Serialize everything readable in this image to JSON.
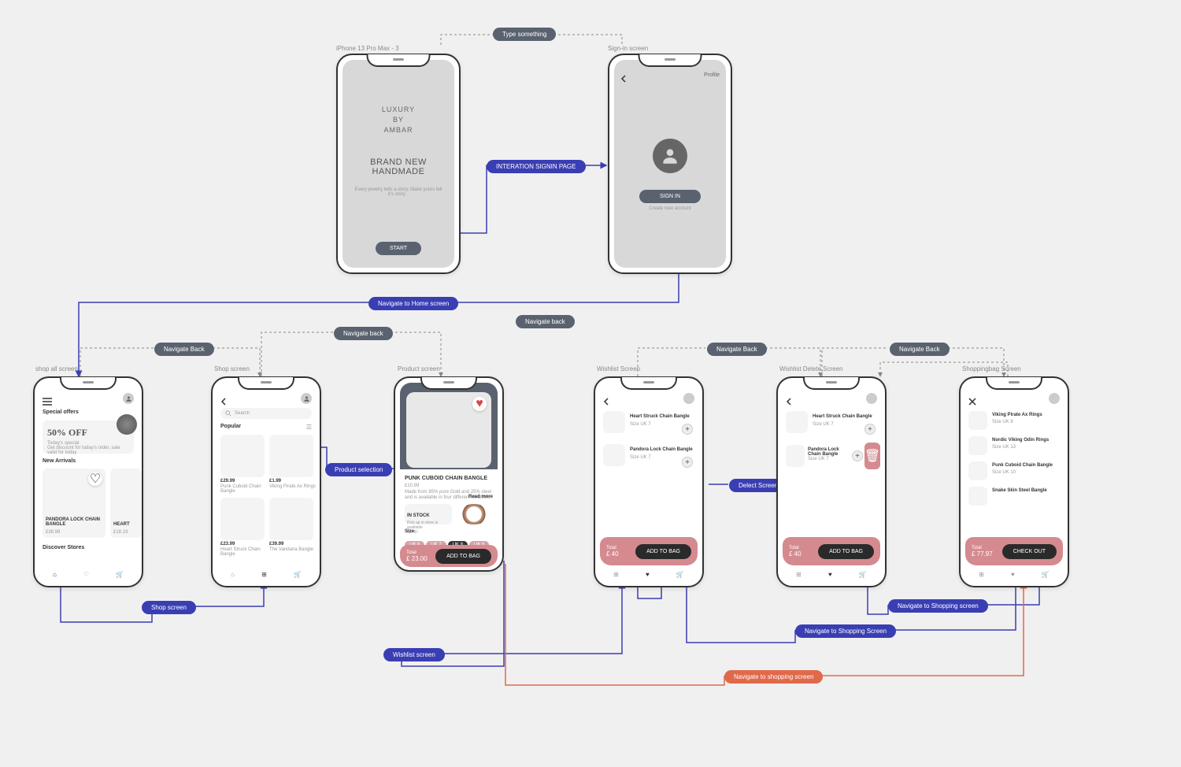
{
  "labels": {
    "splash": "iPhone 13 Pro Max - 3",
    "signin": "Sign-in screen",
    "shopAll": "shop all screen",
    "shop": "Shop screen",
    "product": "Product screen",
    "wishlist": "Wishlist Screen",
    "wishlistDel": "Wishlist Delete Screen",
    "bag": "Shoppingbag Screen"
  },
  "pills": {
    "typeSth": "Type something",
    "signinLink": "INTERATION SIGNIN PAGE",
    "navHome": "Navigate to Home screen",
    "navBack": "Navigate Back",
    "navBack2": "Navigate back",
    "shopScreen": "Shop screen",
    "productSel": "Product selection",
    "wishlistScr": "Wishlist screen",
    "delScreen": "Delect Screen",
    "navShopping": "Navigate to Shopping Screen",
    "navShopping2": "Navigate to Shopping screen",
    "navShopping3": "Navigate to shopping screen"
  },
  "splash": {
    "brand1": "LUXURY",
    "brand2": "BY",
    "brand3": "AMBAR",
    "h1": "BRAND NEW",
    "h2": "HANDMADE",
    "sub": "Every jewelry tells a story. Make yours tell it's story...",
    "start": "START"
  },
  "signin": {
    "profile": "Profile",
    "signin": "SIGN IN",
    "create": "Create new account"
  },
  "shopAll": {
    "special": "Special offers",
    "off": "50% OFF",
    "todays": "Today's special",
    "desc": "Get discount for today's order, sale valid for today",
    "newArr": "New Arrivals",
    "p1": "PANDORA LOCK CHAIN BANGLE",
    "p1p": "£38.99",
    "p2": "HEART",
    "p2p": "£18.19",
    "discover": "Discover Stores"
  },
  "shop": {
    "search": "Search",
    "popular": "Popular",
    "i1p": "£29.99",
    "i1n": "Punk Cuboid Chain\nBangle",
    "i2p": "£1.99",
    "i2n": "Viking Pirate Ax Rings",
    "i3p": "£23.99",
    "i3n": "Heart Struck Chain\nBangle",
    "i4p": "£39.99",
    "i4n": "The Vandana Bangle"
  },
  "product": {
    "name": "PUNK CUBOID CHAIN BANGLE",
    "price": "£10.99",
    "desc": "Made from 85% pure Gold and 25% steel and is available in four different co ations",
    "read": "Read more",
    "stock": "IN STOCK",
    "pickup": "Pick up in store is available",
    "sku": "CD4D",
    "size": "Size",
    "total": "Total",
    "amt": "£ 23.00",
    "cta": "ADD TO BAG"
  },
  "wishlist": {
    "i1": "Heart Struck Chain Bangle",
    "s1": "Size UK 7",
    "i2": "Pandora Lock Chain Bangle",
    "s2": "Size UK 7",
    "total": "Total",
    "amt": "£ 40",
    "cta": "ADD TO BAG"
  },
  "bag": {
    "i1": "Viking Pirate Ax Rings",
    "s1": "Size UK 8",
    "i2": "Nordic Viking Odin Rings",
    "s2": "Size UK 13",
    "i3": "Punk Cuboid Chain Bangle",
    "s3": "Size UK 10",
    "i4": "Snake Skin Steel Bangle",
    "total": "Total",
    "amt": "£ 77.97",
    "cta": "CHECK OUT"
  }
}
